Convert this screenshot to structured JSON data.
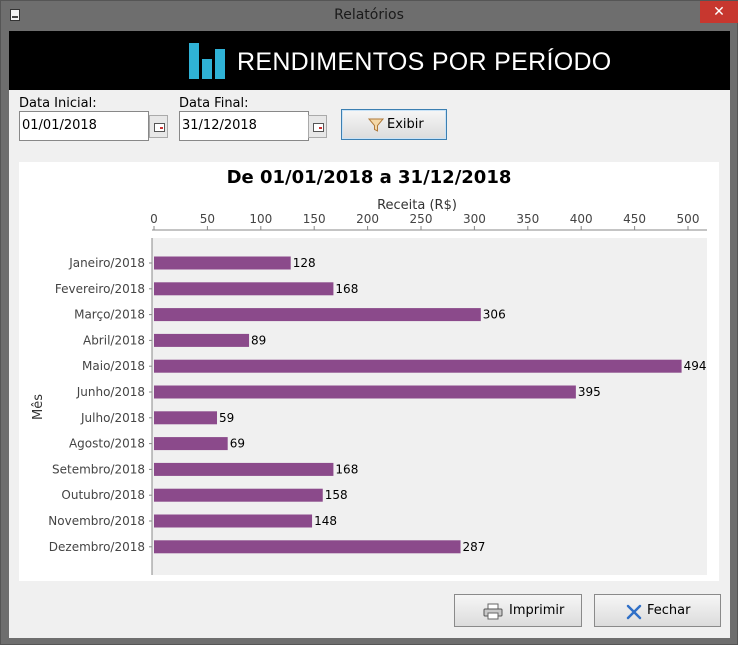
{
  "window": {
    "title": "Relatórios",
    "close_glyph": "✕"
  },
  "banner": {
    "title": "RENDIMENTOS POR PERÍODO",
    "icon": "bar-chart-icon",
    "accent": "#2fb2d6"
  },
  "form": {
    "start_label": "Data Inicial:",
    "start_value": "01/01/2018",
    "end_label": "Data Final:",
    "end_value": "31/12/2018",
    "show_button": "Exibir"
  },
  "buttons": {
    "print": "Imprimir",
    "close": "Fechar"
  },
  "chart_data": {
    "type": "bar",
    "orientation": "horizontal",
    "title": "De 01/01/2018 a 31/12/2018",
    "xlabel": "Receita (R$)",
    "ylabel": "Mês",
    "xlim": [
      0,
      520
    ],
    "x_ticks": [
      0,
      50,
      100,
      150,
      200,
      250,
      300,
      350,
      400,
      450,
      500
    ],
    "x_axis_position": "top",
    "grid": false,
    "bar_color": "#8b4a8b",
    "plot_background": "#f0f0f0",
    "categories": [
      "Janeiro/2018",
      "Fevereiro/2018",
      "Março/2018",
      "Abril/2018",
      "Maio/2018",
      "Junho/2018",
      "Julho/2018",
      "Agosto/2018",
      "Setembro/2018",
      "Outubro/2018",
      "Novembro/2018",
      "Dezembro/2018"
    ],
    "values": [
      128,
      168,
      306,
      89,
      494,
      395,
      59,
      69,
      168,
      158,
      148,
      287
    ]
  }
}
